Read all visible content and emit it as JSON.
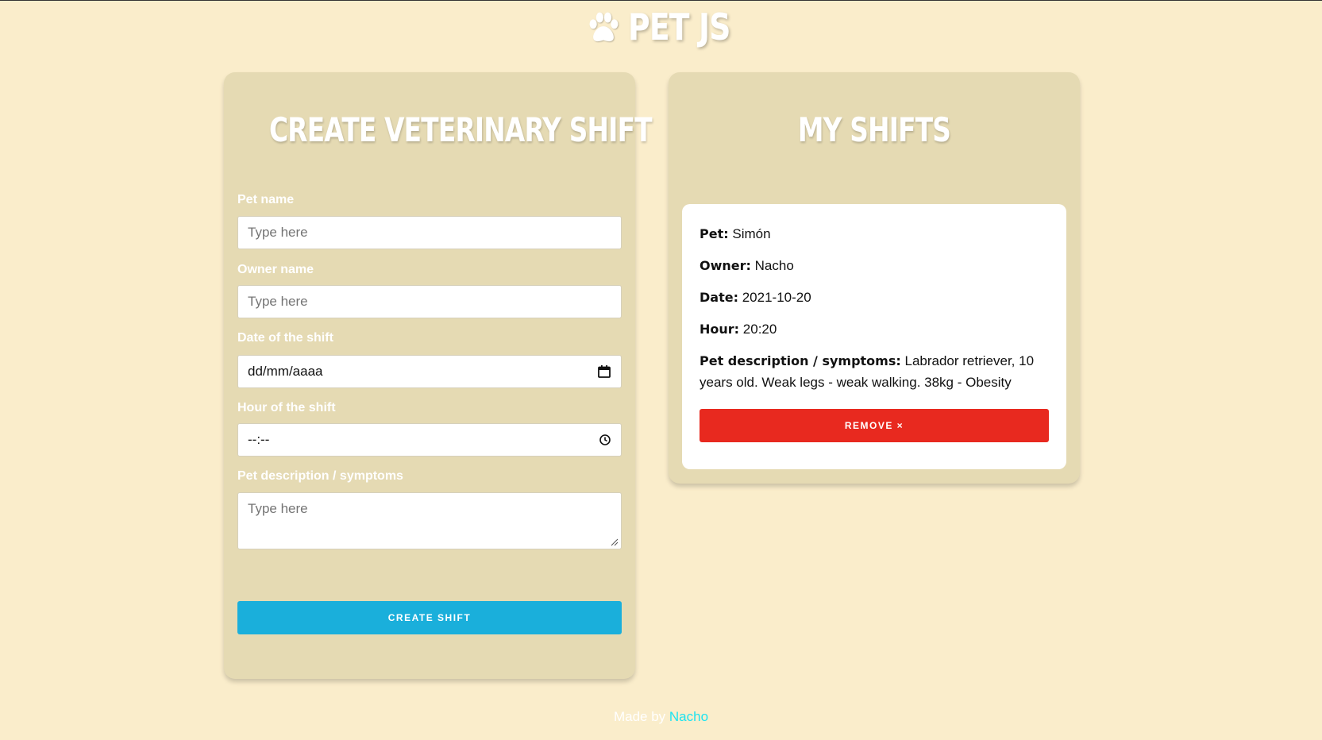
{
  "header": {
    "logo_icon": "paw-icon",
    "brand": "PET JS"
  },
  "form": {
    "title": "Create veterinary shift",
    "pet_name": {
      "label": "Pet name",
      "placeholder": "Type here"
    },
    "owner_name": {
      "label": "Owner name",
      "placeholder": "Type here"
    },
    "date": {
      "label": "Date of the shift",
      "value": "dd/mm/aaaa",
      "icon": "calendar-icon"
    },
    "hour": {
      "label": "Hour of the shift",
      "value": "--:--",
      "icon": "clock-icon"
    },
    "description": {
      "label": "Pet description / symptoms",
      "placeholder": "Type here"
    },
    "submit_label": "Create shift"
  },
  "shifts": {
    "title": "My shifts",
    "items": [
      {
        "pet_label": "Pet:",
        "pet": "Simón",
        "owner_label": "Owner:",
        "owner": "Nacho",
        "date_label": "Date:",
        "date": "2021-10-20",
        "hour_label": "Hour:",
        "hour": "20:20",
        "description_label": "Pet description / symptoms:",
        "description": "Labrador retriever, 10 years old. Weak legs - weak walking. 38kg - Obesity",
        "remove_label": "Remove ×"
      }
    ]
  },
  "footer": {
    "made_by": "Made by",
    "author": "Nacho"
  },
  "colors": {
    "background": "#faedcb",
    "panel": "#e5dab3",
    "primary_button": "#1aafdb",
    "danger_button": "#e8291f",
    "link": "#1ee3f0"
  }
}
